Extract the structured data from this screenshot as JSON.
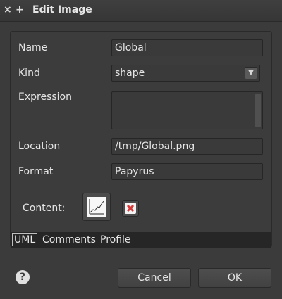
{
  "window": {
    "title": "Edit Image",
    "close_glyph": "×",
    "maximize_glyph": "+"
  },
  "form": {
    "name_label": "Name",
    "name_value": "Global",
    "kind_label": "Kind",
    "kind_value": "shape",
    "expression_label": "Expression",
    "expression_value": "",
    "location_label": "Location",
    "location_value": "/tmp/Global.png",
    "format_label": "Format",
    "format_value": "Papyrus",
    "content_label": "Content:",
    "dropdown_glyph": "▼"
  },
  "tabs": [
    {
      "label": "UML",
      "active": true
    },
    {
      "label": "Comments",
      "active": false
    },
    {
      "label": "Profile",
      "active": false
    }
  ],
  "footer": {
    "help_glyph": "?",
    "cancel_label": "Cancel",
    "ok_label": "OK"
  },
  "colors": {
    "background": "#3c3c3c",
    "field_bg": "#3a3a3a",
    "delete_red": "#d83a3a"
  },
  "icons": {
    "content_preview": "line-graph-thumbnail",
    "delete": "delete-x-icon",
    "help": "help-icon"
  }
}
